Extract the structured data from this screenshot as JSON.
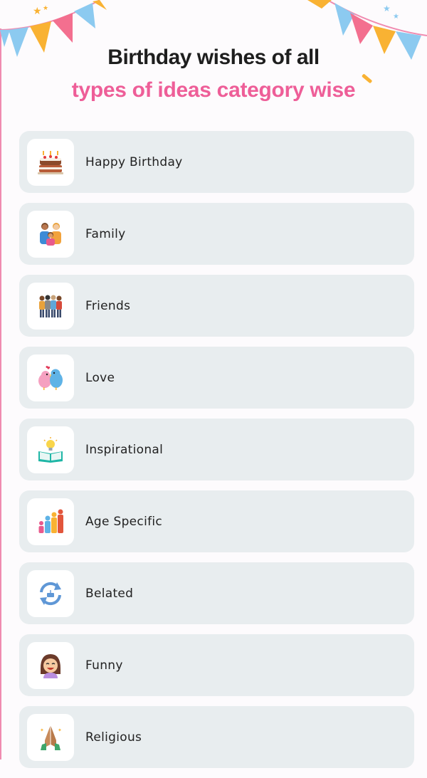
{
  "header": {
    "title_line1": "Birthday wishes of all",
    "title_line2": "types of ideas category wise"
  },
  "colors": {
    "accent_pink": "#ee5e98",
    "card_bg": "#e8edef",
    "bunting": [
      "#f9b233",
      "#f36f8f",
      "#8ccaf0"
    ]
  },
  "categories": [
    {
      "label": "Happy Birthday",
      "icon": "birthday-cake-icon"
    },
    {
      "label": "Family",
      "icon": "family-icon"
    },
    {
      "label": "Friends",
      "icon": "friends-group-icon"
    },
    {
      "label": "Love",
      "icon": "love-birds-icon"
    },
    {
      "label": "Inspirational",
      "icon": "lightbulb-book-icon"
    },
    {
      "label": "Age Specific",
      "icon": "age-people-icon"
    },
    {
      "label": "Belated",
      "icon": "refresh-cake-icon"
    },
    {
      "label": "Funny",
      "icon": "laughing-girl-icon"
    },
    {
      "label": "Religious",
      "icon": "praying-hands-icon"
    }
  ]
}
